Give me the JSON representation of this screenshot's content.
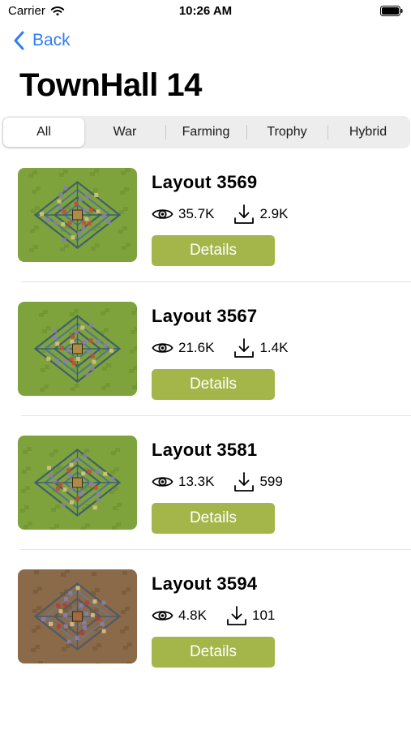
{
  "status_bar": {
    "carrier": "Carrier",
    "time": "10:26 AM"
  },
  "nav": {
    "back_label": "Back"
  },
  "page_title": "TownHall 14",
  "segments": {
    "selected": "All",
    "items": [
      "All",
      "War",
      "Farming",
      "Trophy",
      "Hybrid"
    ]
  },
  "layouts": [
    {
      "name": "Layout 3569",
      "views": "35.7K",
      "downloads": "2.9K",
      "details_label": "Details",
      "thumb_tone": "green"
    },
    {
      "name": "Layout 3567",
      "views": "21.6K",
      "downloads": "1.4K",
      "details_label": "Details",
      "thumb_tone": "green"
    },
    {
      "name": "Layout 3581",
      "views": "13.3K",
      "downloads": "599",
      "details_label": "Details",
      "thumb_tone": "green"
    },
    {
      "name": "Layout 3594",
      "views": "4.8K",
      "downloads": "101",
      "details_label": "Details",
      "thumb_tone": "brown"
    }
  ],
  "colors": {
    "accent_blue": "#2f7cf6",
    "details_button": "#a4b64a",
    "segment_bg": "#ededee"
  },
  "icons": {
    "wifi": "wifi-icon",
    "battery": "battery-icon",
    "back": "chevron-left-icon",
    "views": "eye-icon",
    "downloads": "download-icon"
  }
}
